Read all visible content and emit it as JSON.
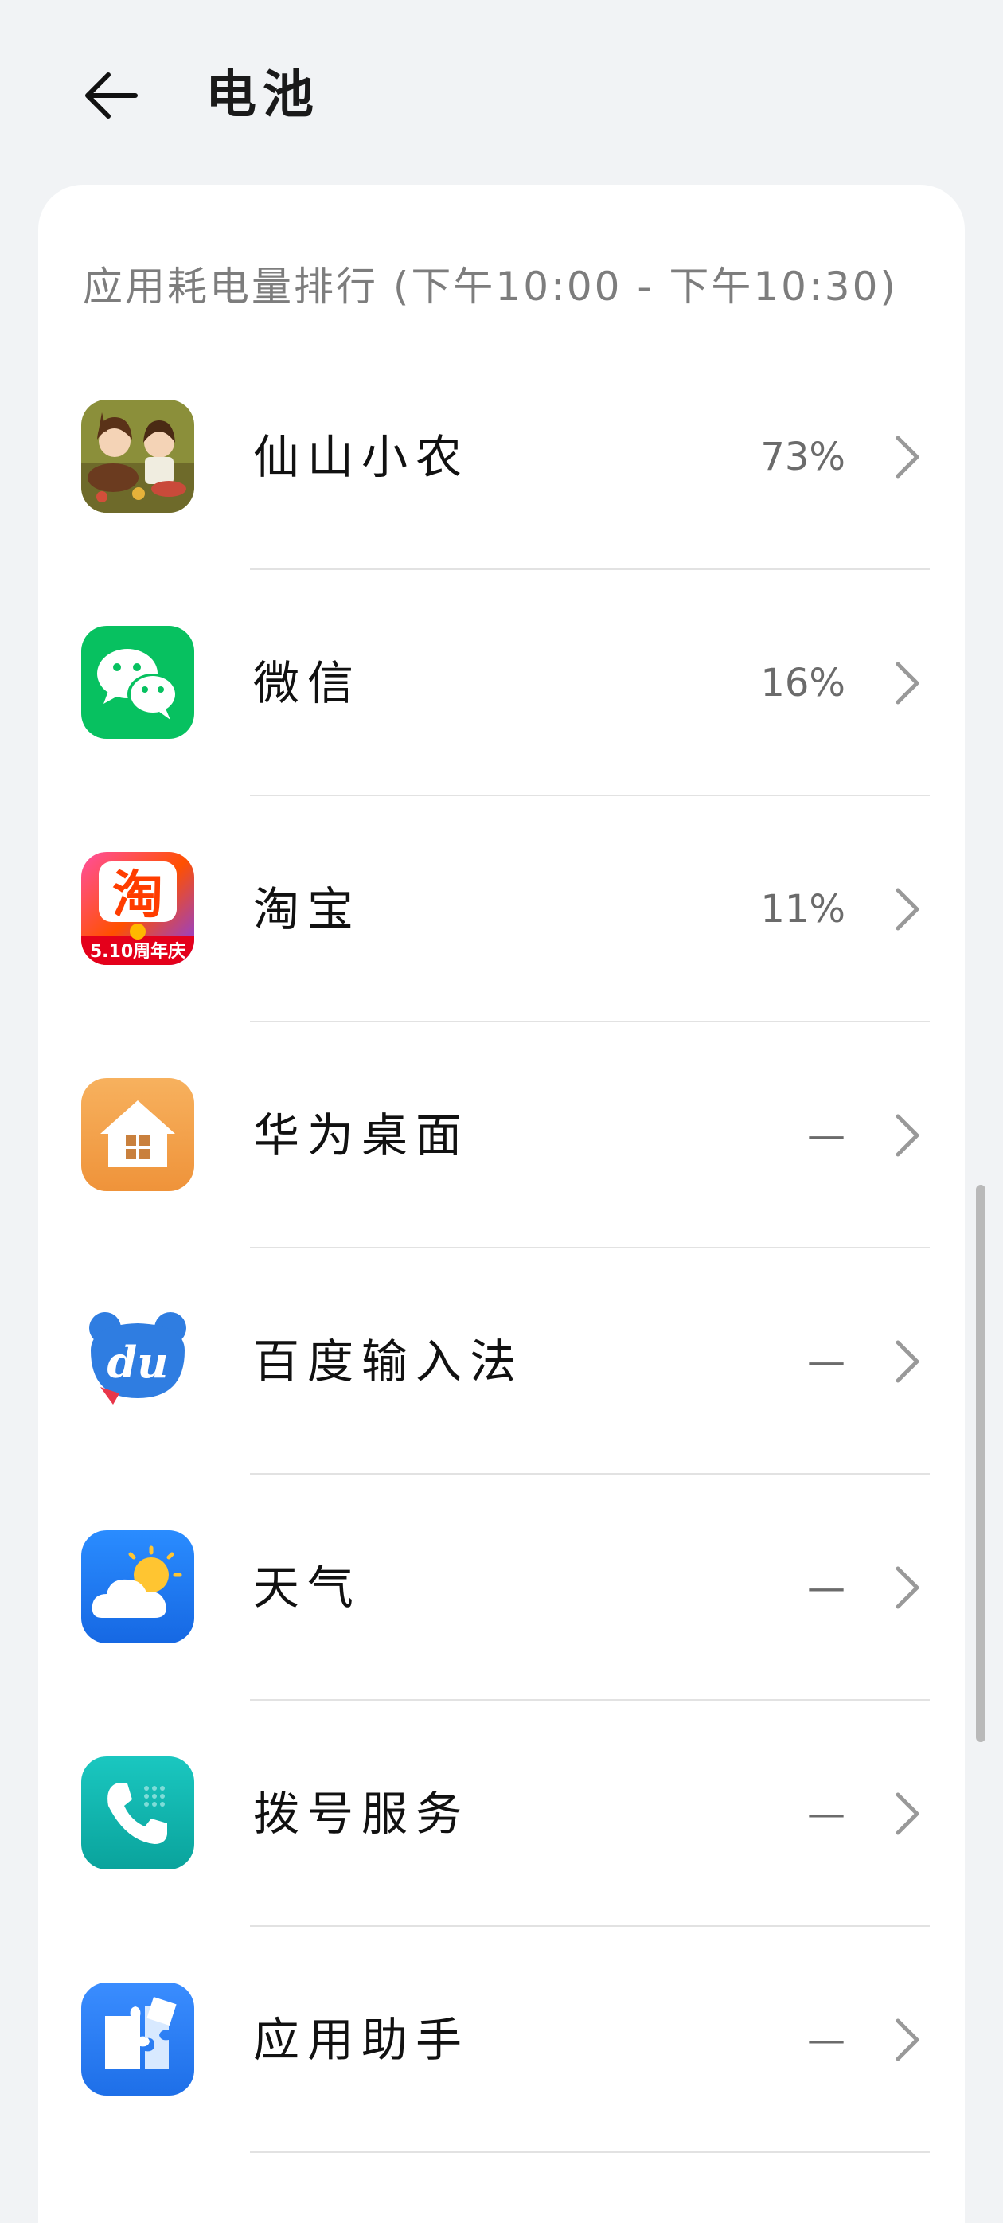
{
  "header": {
    "back_icon": "arrow-left-icon",
    "title": "电池"
  },
  "section": {
    "title": "应用耗电量排行 (下午10:00 - 下午10:30)"
  },
  "apps": [
    {
      "name": "仙山小农",
      "value": "73%",
      "icon": "xianshan-xiaonong-game-icon"
    },
    {
      "name": "微信",
      "value": "16%",
      "icon": "wechat-icon"
    },
    {
      "name": "淘宝",
      "value": "11%",
      "icon": "taobao-icon",
      "icon_badge": "5.10周年庆"
    },
    {
      "name": "华为桌面",
      "value": "—",
      "icon": "huawei-launcher-home-icon"
    },
    {
      "name": "百度输入法",
      "value": "—",
      "icon": "baidu-input-icon",
      "icon_text": "du"
    },
    {
      "name": "天气",
      "value": "—",
      "icon": "weather-icon"
    },
    {
      "name": "拨号服务",
      "value": "—",
      "icon": "phone-dialer-icon"
    },
    {
      "name": "应用助手",
      "value": "—",
      "icon": "app-assistant-puzzle-icon"
    }
  ],
  "colors": {
    "background": "#f1f3f5",
    "card": "#ffffff",
    "primary_text": "#111111",
    "secondary_text": "#7d7d7d",
    "wechat_green": "#07c160",
    "taobao_orange": "#ff5000",
    "huawei_home_orange": "#f4a14c",
    "baidu_blue": "#2f7de1",
    "weather_blue": "#1f7cf2",
    "dialer_teal": "#13b3ad",
    "assistant_blue": "#2b7ef5"
  }
}
